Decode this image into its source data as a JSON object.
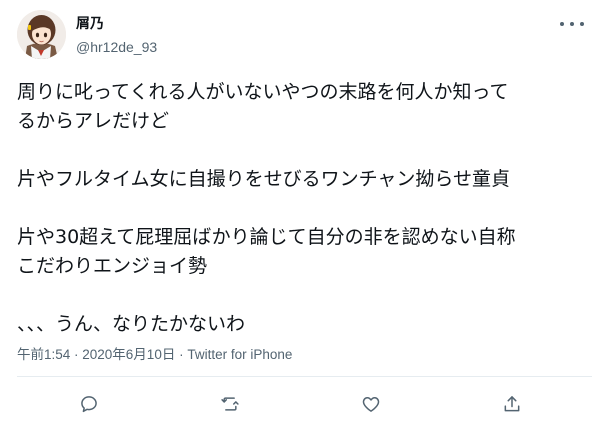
{
  "tweet": {
    "user": {
      "display_name": "屑乃",
      "handle": "@hr12de_93"
    },
    "lines": [
      "周りに叱ってくれる人がいないやつの末路を何人か知って",
      "るからアレだけど",
      "片やフルタイム女に自撮りをせびるワンチャン拗らせ童貞",
      "片や30超えて屁理屈ばかり論じて自分の非を認めない自称",
      "こだわりエンジョイ勢",
      "、、、うん、なりたかないわ"
    ],
    "timestamp": "午前1:54 · 2020年6月10日 · ",
    "source": "Twitter for iPhone"
  },
  "icons": {
    "more": "more-dots-icon",
    "reply": "reply-icon",
    "retweet": "retweet-icon",
    "like": "heart-icon",
    "share": "share-icon"
  },
  "colors": {
    "text": "#0f1419",
    "secondary": "#536471",
    "divider": "#e6ecf0"
  }
}
